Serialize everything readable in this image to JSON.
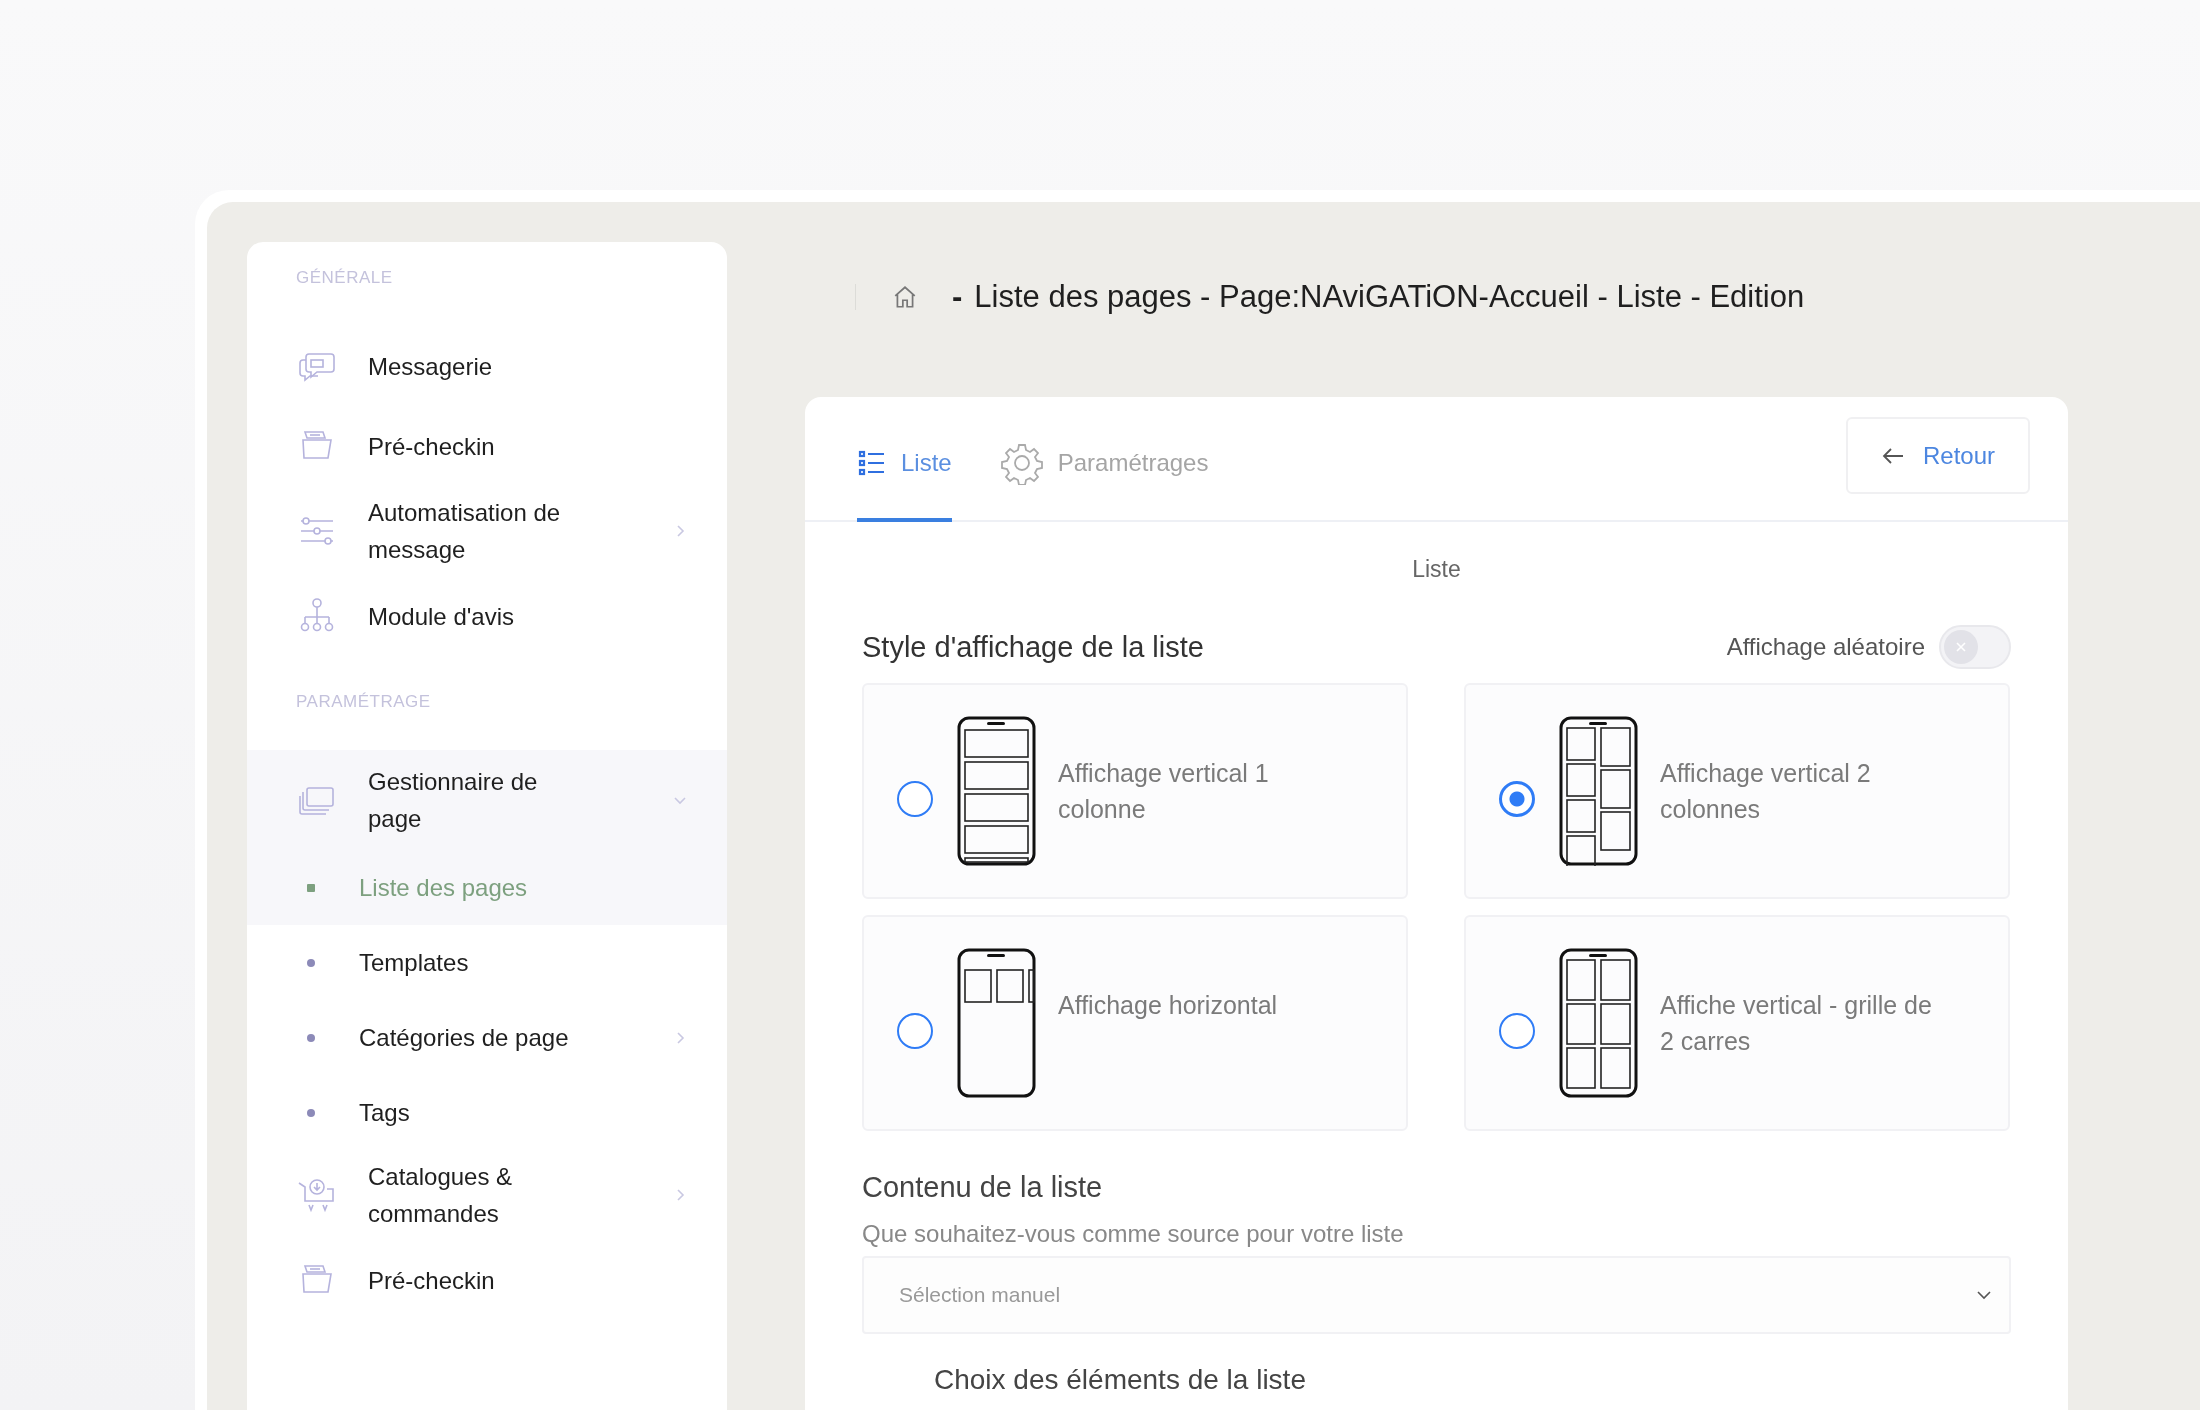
{
  "sidebar": {
    "sections": [
      {
        "title": "GÉNÉRALE",
        "items": [
          {
            "kind": "item",
            "label": "Messagerie"
          },
          {
            "kind": "item",
            "label": "Pré-checkin"
          },
          {
            "kind": "item",
            "label": "Automatisation de message",
            "expanded": false
          },
          {
            "kind": "item",
            "label": "Module d'avis"
          }
        ]
      },
      {
        "title": "PARAMÉTRAGE",
        "items": [
          {
            "kind": "item",
            "label": "Gestionnaire de page",
            "expanded": true
          },
          {
            "kind": "sub",
            "label": "Liste des pages",
            "selected": true
          },
          {
            "kind": "sub",
            "label": "Templates",
            "selected": false
          },
          {
            "kind": "sub",
            "label": "Catégories de page",
            "selected": false,
            "expanded": false
          },
          {
            "kind": "sub",
            "label": "Tags",
            "selected": false
          },
          {
            "kind": "item",
            "label": "Catalogues & commandes",
            "expanded": false
          },
          {
            "kind": "item",
            "label": "Pré-checkin"
          }
        ]
      }
    ]
  },
  "breadcrumb": {
    "dash": "-",
    "path": "Liste des pages - Page:NAviGATiON-Accueil - Liste - Edition"
  },
  "tabs": [
    {
      "label": "Liste",
      "selected": true
    },
    {
      "label": "Paramétrages",
      "selected": false
    }
  ],
  "back_button": {
    "label": "Retour"
  },
  "panel_title": "Liste",
  "display_style": {
    "title": "Style d'affichage de la liste",
    "random": {
      "label": "Affichage aléatoire",
      "on": false
    },
    "options": [
      {
        "label": "Affichage vertical 1 colonne",
        "selected": false
      },
      {
        "label": "Affichage vertical 2 colonnes",
        "selected": true
      },
      {
        "label": "Affichage horizontal",
        "selected": false
      },
      {
        "label": "Affiche vertical - grille de 2 carres",
        "selected": false
      }
    ]
  },
  "content": {
    "title": "Contenu de la liste",
    "question": "Que souhaitez-vous comme source pour votre liste",
    "source": {
      "value": "Sélection manuel"
    },
    "next_title": "Choix des éléments de la liste"
  }
}
